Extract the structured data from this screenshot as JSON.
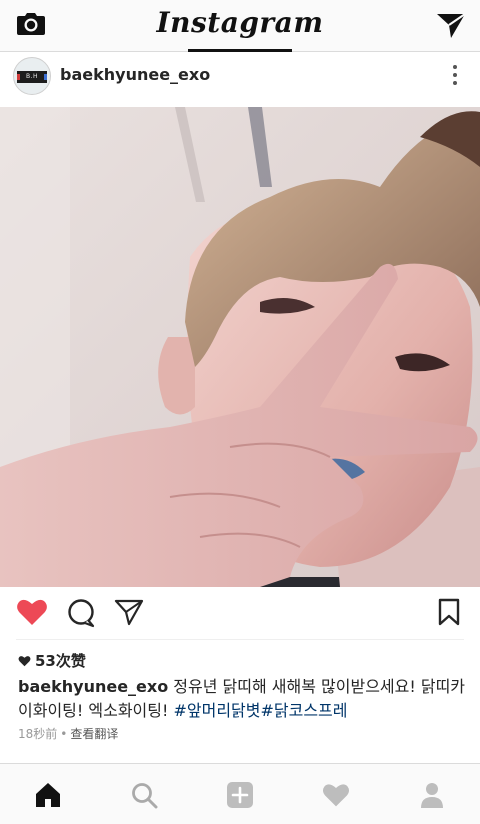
{
  "app": {
    "brand": "Instagram",
    "colors": {
      "accent": "#ed4956",
      "link": "#003569",
      "muted": "#999999",
      "text": "#262626"
    }
  },
  "topbar": {
    "left_icon": "camera-icon",
    "right_icon": "direct-message-icon"
  },
  "post": {
    "author": "baekhyunee_exo",
    "avatar_text": "B.H",
    "more_icon": "more-vertical-icon",
    "photo_icon": "selfie-photo",
    "liked": true,
    "likes": "53次赞",
    "caption": {
      "user": "baekhyunee_exo",
      "text": " 정유년 닭띠해 새해복 많이받으세요! 닭띠카이화이팅! 엑소화이팅! ",
      "tags": "#앞머리닭볏#닭코스프레"
    },
    "time": "18秒前",
    "separator": "•",
    "translate": "查看翻译"
  },
  "bottom_nav": {
    "items": [
      "home-icon",
      "search-icon",
      "add-icon",
      "activity-heart-icon",
      "profile-icon"
    ]
  }
}
